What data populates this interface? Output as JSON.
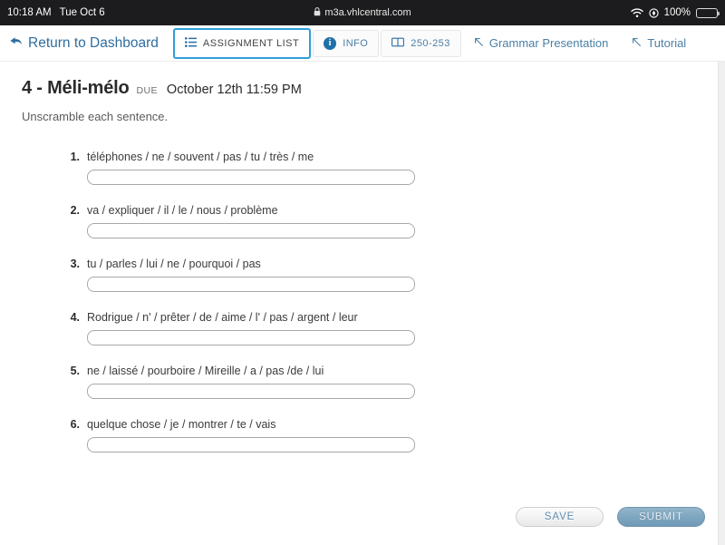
{
  "statusbar": {
    "time": "10:18 AM",
    "date": "Tue Oct 6",
    "url": "m3a.vhlcentral.com",
    "lock_glyph": "🔒",
    "battery_percent": "100%",
    "icons": [
      "wifi-icon",
      "location-icon",
      "battery-icon"
    ]
  },
  "nav": {
    "return_label": "Return to Dashboard",
    "tabs": [
      {
        "label": "ASSIGNMENT LIST",
        "icon": "list-icon",
        "active": true
      },
      {
        "label": "INFO",
        "icon": "info-circle-icon",
        "active": false
      },
      {
        "label": "250-253",
        "icon": "book-icon",
        "active": false
      }
    ],
    "links": [
      {
        "label": "Grammar Presentation",
        "icon": "external-link-arrow-icon"
      },
      {
        "label": "Tutorial",
        "icon": "external-link-arrow-icon"
      }
    ]
  },
  "assignment": {
    "title": "4 - Méli-mélo",
    "due_label": "DUE",
    "due_date": "October 12th 11:59 PM",
    "instructions": "Unscramble each sentence."
  },
  "exercises": [
    {
      "num": "1.",
      "prompt": "téléphones / ne / souvent / pas / tu / très / me",
      "answer": "",
      "placeholder": ""
    },
    {
      "num": "2.",
      "prompt": "va / expliquer / il / le / nous / problème",
      "answer": "",
      "placeholder": ""
    },
    {
      "num": "3.",
      "prompt": "tu / parles / lui / ne / pourquoi / pas",
      "answer": "",
      "placeholder": ""
    },
    {
      "num": "4.",
      "prompt": "Rodrigue / n' / prêter / de / aime / l' / pas / argent / leur",
      "answer": "",
      "placeholder": ""
    },
    {
      "num": "5.",
      "prompt": "ne / laissé / pourboire / Mireille / a / pas /de / lui",
      "answer": "",
      "placeholder": ""
    },
    {
      "num": "6.",
      "prompt": "quelque chose / je / montrer / te / vais",
      "answer": "",
      "placeholder": ""
    }
  ],
  "footer": {
    "save_label": "SAVE",
    "submit_label": "SUBMIT"
  },
  "colors": {
    "accent_blue": "#2f9fd8",
    "link_blue": "#4a7fa5",
    "statusbar_bg": "#1c1c1e",
    "submit_blue": "#7fa6c0"
  }
}
